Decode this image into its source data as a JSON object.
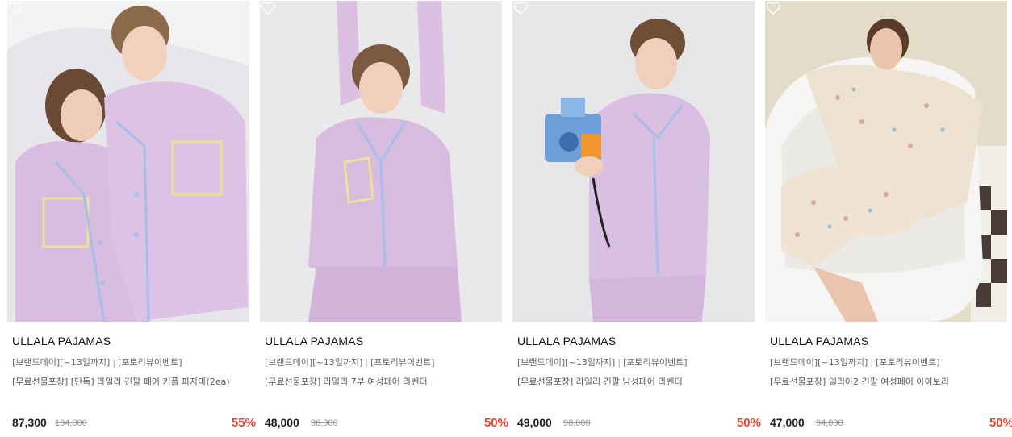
{
  "accent_color": "#e8442f",
  "products": [
    {
      "brand": "ULLALA PAJAMAS",
      "event_1": "[브랜드데이][~13일까지]",
      "event_sep": "|",
      "event_2": "[포토리뷰이벤트]",
      "name": "[무료선물포장] [단독] 라일리 긴팔 페어 커플 파자마(2ea)",
      "price": "87,300",
      "original_price": "194,000",
      "discount": "55%",
      "image_subject": "couple-lavender-pajamas"
    },
    {
      "brand": "ULLALA PAJAMAS",
      "event_1": "[브랜드데이][~13일까지]",
      "event_sep": "|",
      "event_2": "[포토리뷰이벤트]",
      "name": "[무료선물포장] 라일리 7부 여성페어 라벤더",
      "price": "48,000",
      "original_price": "96,000",
      "discount": "50%",
      "image_subject": "woman-lavender-pajamas"
    },
    {
      "brand": "ULLALA PAJAMAS",
      "event_1": "[브랜드데이][~13일까지]",
      "event_sep": "|",
      "event_2": "[포토리뷰이벤트]",
      "name": "[무료선물포장] 라일리 긴팔 남성페어 라벤더",
      "price": "49,000",
      "original_price": "98,000",
      "discount": "50%",
      "image_subject": "man-lavender-pajamas-camera"
    },
    {
      "brand": "ULLALA PAJAMAS",
      "event_1": "[브랜드데이][~13일까지]",
      "event_sep": "|",
      "event_2": "[포토리뷰이벤트]",
      "name": "[무료선물포장] 델리아2 긴팔 여성페어 아이보리",
      "price": "47,000",
      "original_price": "94,000",
      "discount": "50%",
      "image_subject": "woman-floral-pajamas-bathtub"
    }
  ]
}
